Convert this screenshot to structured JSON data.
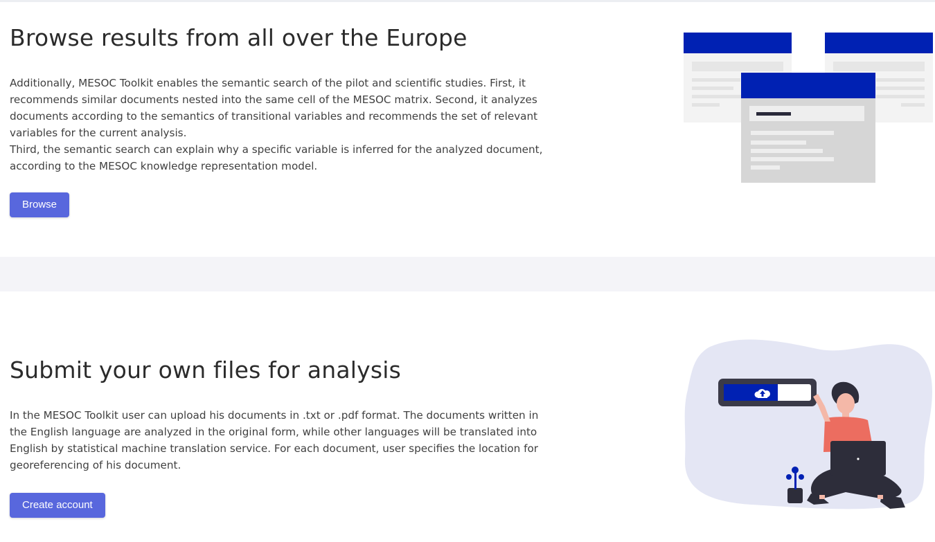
{
  "browse_section": {
    "heading": "Browse results from all over the Europe",
    "paragraph_lines": [
      "Additionally, MESOC Toolkit enables the semantic search of the pilot and scientific studies. First, it",
      "recommends similar documents nested into the same cell of the MESOC matrix. Second, it analyzes",
      "documents according to the semantics of transitional variables and recommends the set of relevant",
      "variables for the current analysis.",
      "Third, the semantic search can explain why a specific variable is inferred for the analyzed document,",
      "according to the MESOC knowledge representation model."
    ],
    "button_label": "Browse",
    "illustration_icon": "documents-browse-illustration"
  },
  "submit_section": {
    "heading": "Submit your own files for analysis",
    "paragraph_lines": [
      "In the MESOC Toolkit user can upload his documents in .txt or .pdf format. The documents written in",
      "the English language are analyzed in the original form, while other languages will be translated into",
      "English by statistical machine translation service. For each document, user specifies the location for",
      "georeferencing of his document."
    ],
    "button_label": "Create account",
    "illustration_icon": "person-uploading-file-illustration"
  },
  "colors": {
    "button": "#5867dd",
    "illustration_blue": "#0021b3",
    "band": "#f4f4f8",
    "blob": "#e4e6f4"
  }
}
